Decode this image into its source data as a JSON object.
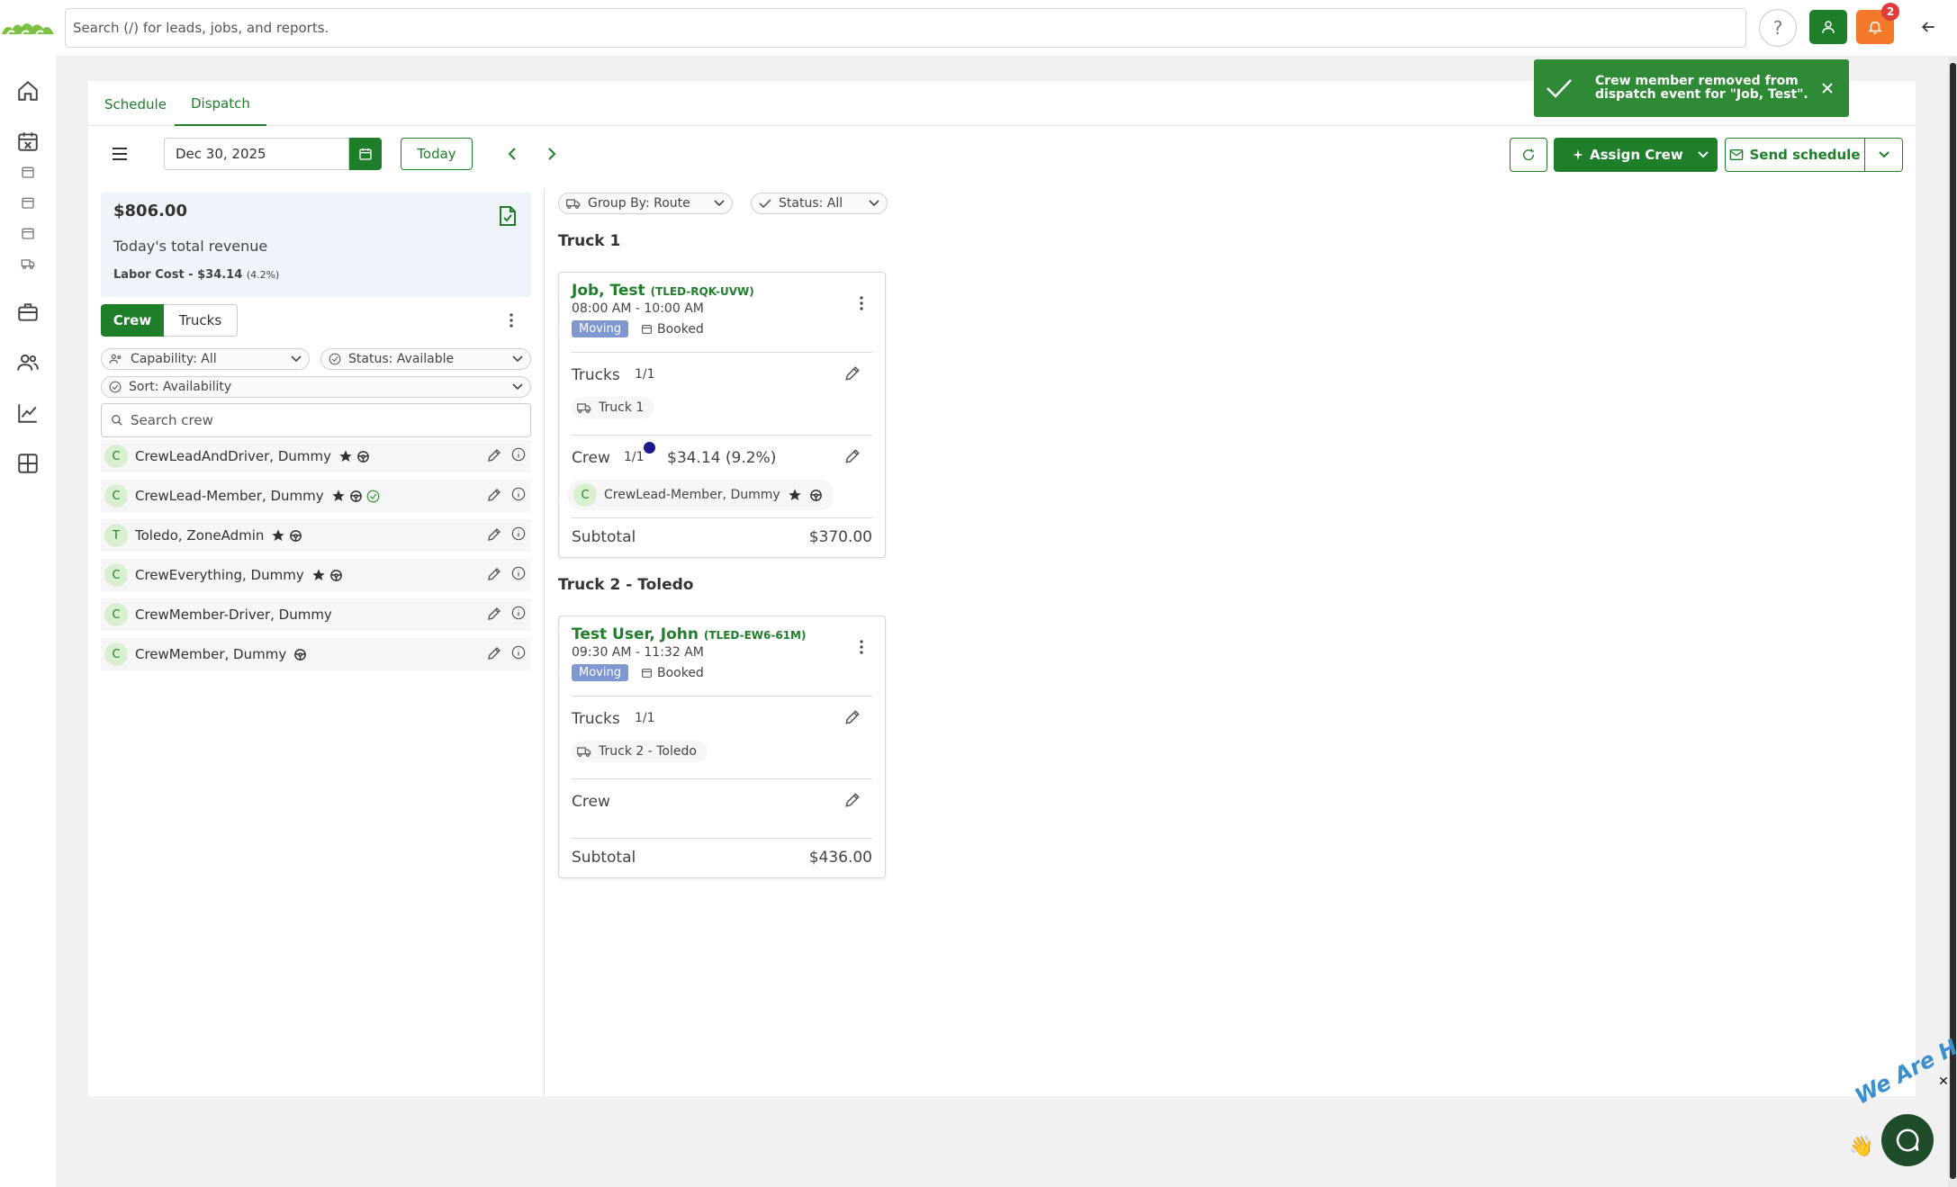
{
  "search": {
    "placeholder": "Search (/) for leads, jobs, and reports."
  },
  "header": {
    "help_label": "?",
    "notification_count": "2"
  },
  "tabs": [
    {
      "label": "Schedule",
      "active": false
    },
    {
      "label": "Dispatch",
      "active": true
    }
  ],
  "toast": {
    "message": "Crew member removed from dispatch event for \"Job, Test\"."
  },
  "toolbar": {
    "date": "Dec 30, 2025",
    "today_label": "Today",
    "assign_label": "Assign Crew",
    "send_label": "Send schedule"
  },
  "revenue": {
    "amount": "$806.00",
    "label": "Today's total revenue",
    "labor": "Labor Cost - $34.14",
    "labor_pct": "(4.2%)"
  },
  "segments": {
    "crew": "Crew",
    "trucks": "Trucks"
  },
  "filters": {
    "capability": "Capability: All",
    "status": "Status: Available",
    "sort": "Sort: Availability",
    "search_placeholder": "Search crew"
  },
  "crew_list": [
    {
      "initial": "C",
      "name": "CrewLeadAndDriver, Dummy",
      "star": true,
      "wheel": true,
      "check": false
    },
    {
      "initial": "C",
      "name": "CrewLead-Member, Dummy",
      "star": true,
      "wheel": true,
      "check": true
    },
    {
      "initial": "T",
      "name": "Toledo, ZoneAdmin",
      "star": true,
      "wheel": true,
      "check": false
    },
    {
      "initial": "C",
      "name": "CrewEverything, Dummy",
      "star": true,
      "wheel": true,
      "check": false
    },
    {
      "initial": "C",
      "name": "CrewMember-Driver, Dummy",
      "star": false,
      "wheel": false,
      "check": false
    },
    {
      "initial": "C",
      "name": "CrewMember, Dummy",
      "star": false,
      "wheel": true,
      "check": false
    }
  ],
  "dispatch": {
    "group_by": "Group By: Route",
    "status": "Status: All",
    "routes": [
      {
        "title": "Truck 1",
        "job": {
          "name": "Job, Test",
          "code": "(TLED-RQK-UVW)",
          "time": "08:00 AM - 10:00 AM",
          "type": "Moving",
          "status": "Booked",
          "trucks_label": "Trucks",
          "trucks_count": "1/1",
          "truck": "Truck 1",
          "crew_label": "Crew",
          "crew_count": "1/1",
          "crew_cost": "$34.14 (9.2%)",
          "crew_member": {
            "initial": "C",
            "name": "CrewLead-Member, Dummy"
          },
          "subtotal_label": "Subtotal",
          "subtotal": "$370.00"
        }
      },
      {
        "title": "Truck 2 - Toledo",
        "job": {
          "name": "Test User, John",
          "code": "(TLED-EW6-61M)",
          "time": "09:30 AM - 11:32 AM",
          "type": "Moving",
          "status": "Booked",
          "trucks_label": "Trucks",
          "trucks_count": "1/1",
          "truck": "Truck 2 - Toledo",
          "crew_label": "Crew",
          "subtotal_label": "Subtotal",
          "subtotal": "$436.00"
        }
      }
    ]
  },
  "chat": {
    "text": "We Are Here!"
  },
  "colors": {
    "brand": "#1e7e2a",
    "notification": "#f5792a",
    "moving_tag": "#7f98d2",
    "toast": "#2f8a35"
  }
}
